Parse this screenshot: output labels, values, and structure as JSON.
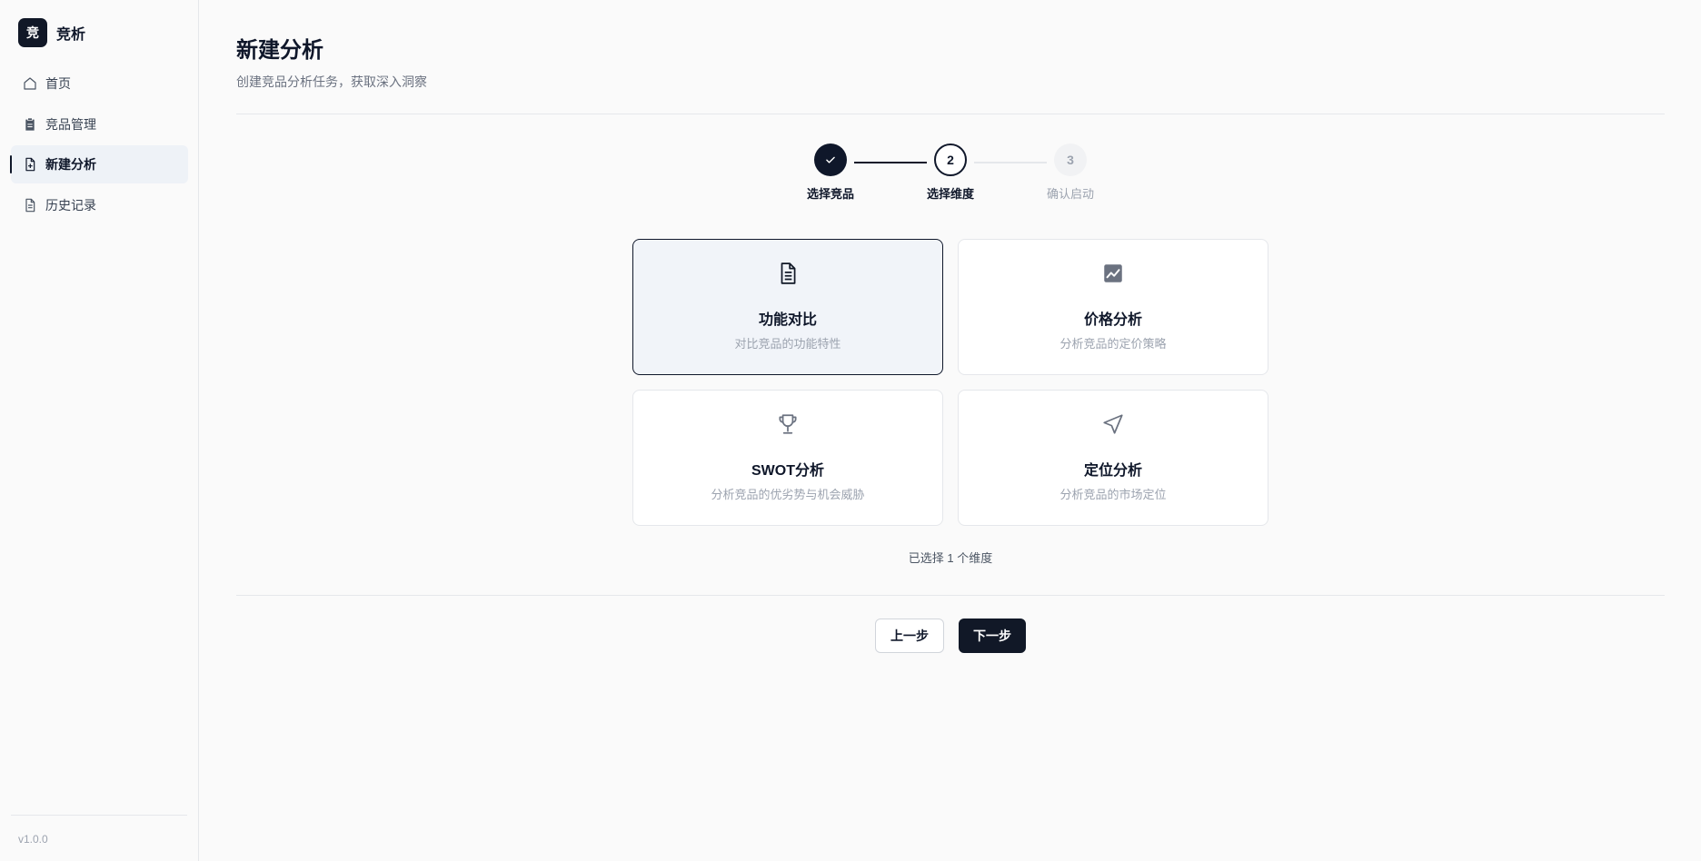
{
  "brand": {
    "mark": "竞",
    "name": "竞析"
  },
  "sidebar": {
    "items": [
      {
        "label": "首页",
        "icon": "home-icon",
        "active": false
      },
      {
        "label": "竞品管理",
        "icon": "clipboard-icon",
        "active": false
      },
      {
        "label": "新建分析",
        "icon": "file-plus-icon",
        "active": true
      },
      {
        "label": "历史记录",
        "icon": "file-text-icon",
        "active": false
      }
    ],
    "version": "v1.0.0"
  },
  "header": {
    "title": "新建分析",
    "subtitle": "创建竞品分析任务，获取深入洞察"
  },
  "stepper": {
    "steps": [
      {
        "label": "选择竞品",
        "number": "1",
        "status": "done"
      },
      {
        "label": "选择维度",
        "number": "2",
        "status": "current"
      },
      {
        "label": "确认启动",
        "number": "3",
        "status": "pending"
      }
    ]
  },
  "dimensions": [
    {
      "title": "功能对比",
      "desc": "对比竞品的功能特性",
      "icon": "document-icon",
      "selected": true
    },
    {
      "title": "价格分析",
      "desc": "分析竞品的定价策略",
      "icon": "chart-icon",
      "selected": false
    },
    {
      "title": "SWOT分析",
      "desc": "分析竞品的优劣势与机会威胁",
      "icon": "trophy-icon",
      "selected": false
    },
    {
      "title": "定位分析",
      "desc": "分析竞品的市场定位",
      "icon": "navigation-icon",
      "selected": false
    }
  ],
  "selection_summary": "已选择 1 个维度",
  "actions": {
    "prev": "上一步",
    "next": "下一步"
  },
  "colors": {
    "primary": "#0f172a",
    "selected_bg": "#f1f4f9",
    "muted": "#9ca3af"
  }
}
